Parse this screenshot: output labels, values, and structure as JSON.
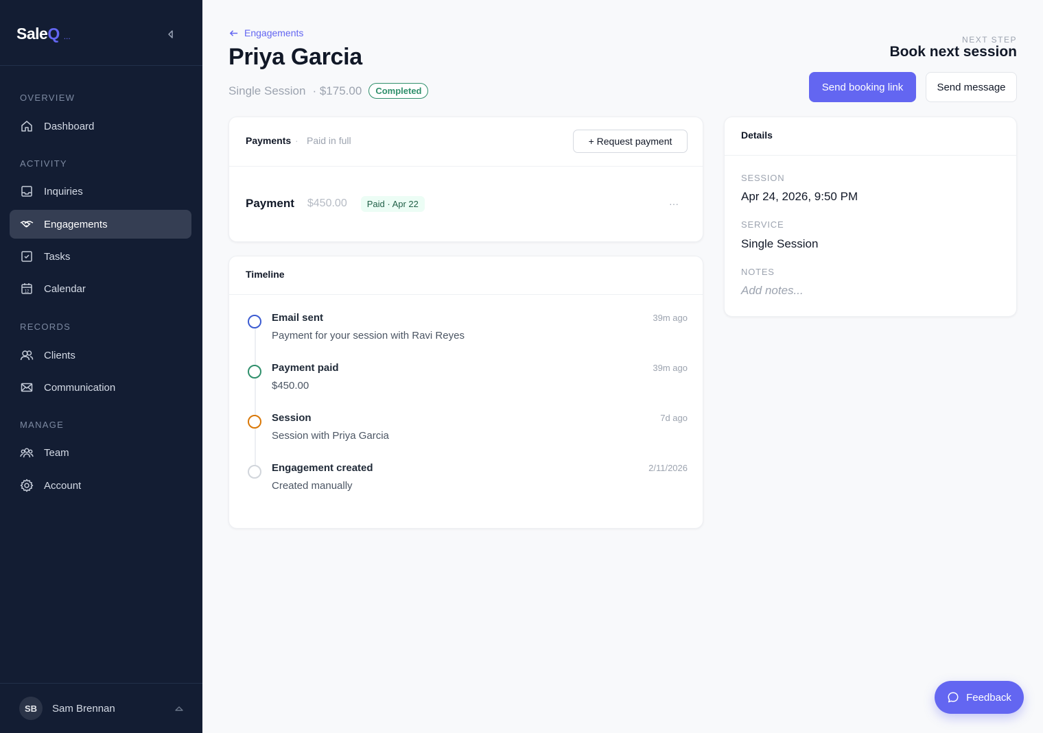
{
  "brand": {
    "name": "Sale",
    "accent": "Q",
    "dots": "..."
  },
  "sidebar": {
    "sections": [
      {
        "label": "OVERVIEW"
      },
      {
        "label": "ACTIVITY"
      },
      {
        "label": "RECORDS"
      },
      {
        "label": "MANAGE"
      }
    ],
    "items": [
      {
        "label": "Dashboard",
        "icon": "home-icon"
      },
      {
        "label": "Inquiries",
        "icon": "inbox-icon"
      },
      {
        "label": "Engagements",
        "icon": "handshake-icon",
        "active": true
      },
      {
        "label": "Tasks",
        "icon": "checkbox-icon"
      },
      {
        "label": "Calendar",
        "icon": "calendar-icon"
      },
      {
        "label": "Clients",
        "icon": "users-icon"
      },
      {
        "label": "Communication",
        "icon": "mail-icon"
      },
      {
        "label": "Team",
        "icon": "team-icon"
      },
      {
        "label": "Account",
        "icon": "gear-icon"
      }
    ],
    "calendar_day": "12",
    "user": {
      "initials": "SB",
      "name": "Sam Brennan"
    }
  },
  "header": {
    "back_label": "Engagements",
    "title": "Priya Garcia",
    "service": "Single Session",
    "price": "· $175.00",
    "status": "Completed",
    "next_step_label": "NEXT STEP",
    "next_step_title": "Book next session",
    "primary_button": "Send booking link",
    "secondary_button": "Send message"
  },
  "payments": {
    "title": "Payments",
    "separator": "·",
    "status": "Paid in full",
    "request_button": "+ Request payment",
    "row": {
      "name": "Payment",
      "amount": "$450.00",
      "badge": "Paid · Apr 22",
      "more": "···"
    }
  },
  "timeline": {
    "title": "Timeline",
    "items": [
      {
        "title": "Email sent",
        "desc": "Payment for your session with Ravi Reyes",
        "time": "39m ago",
        "color": "#3b5bd1"
      },
      {
        "title": "Payment paid",
        "desc": "$450.00",
        "time": "39m ago",
        "color": "#2f8f6b"
      },
      {
        "title": "Session",
        "desc": "Session with Priya Garcia",
        "time": "7d ago",
        "color": "#d97706"
      },
      {
        "title": "Engagement created",
        "desc": "Created manually",
        "time": "2/11/2026",
        "color": "#d1d5db"
      }
    ]
  },
  "details": {
    "title": "Details",
    "session_label": "SESSION",
    "session_value": "Apr 24, 2026, 9:50 PM",
    "service_label": "SERVICE",
    "service_value": "Single Session",
    "notes_label": "NOTES",
    "notes_placeholder": "Add notes..."
  },
  "feedback": {
    "label": "Feedback"
  },
  "colors": {
    "accent": "#6366f1",
    "sidebar": "#131d33",
    "success": "#2f8f6b"
  }
}
